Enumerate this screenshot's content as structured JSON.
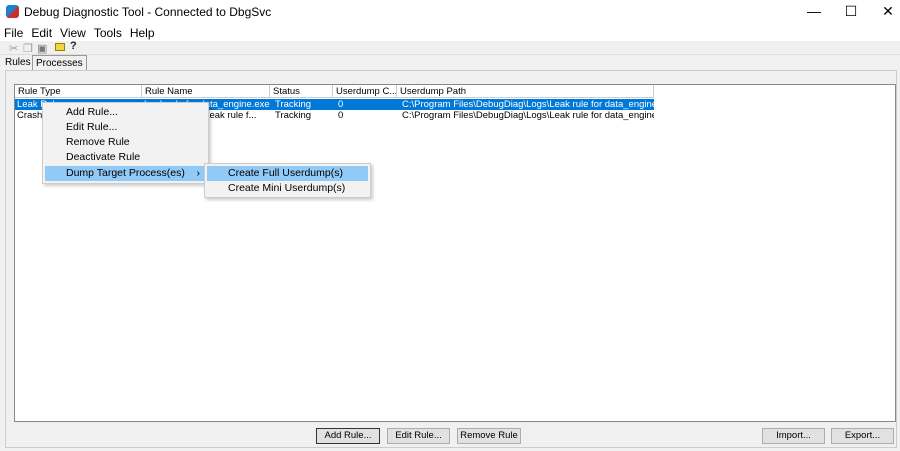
{
  "window": {
    "title": "Debug Diagnostic Tool - Connected to DbgSvc",
    "minimize": "—",
    "maximize": "☐",
    "close": "✕"
  },
  "menu": [
    "File",
    "Edit",
    "View",
    "Tools",
    "Help"
  ],
  "toolbar": {
    "icons": [
      "cut-icon",
      "copy-icon",
      "paste-icon",
      "open-folder-icon",
      "help-icon"
    ]
  },
  "tabs": [
    "Rules",
    "Processes"
  ],
  "columns": [
    "Rule Type",
    "Rule Name",
    "Status",
    "Userdump C...",
    "Userdump Path"
  ],
  "rows": [
    {
      "type": "Leak Rule",
      "name": "Leak rule for data_engine.exe(...",
      "status": "Tracking",
      "count": "0",
      "path": "C:\\Program Files\\DebugDiag\\Logs\\Leak rule for data_engine.exe(..."
    },
    {
      "type": "Crash Rule",
      "name": "Crash rule for Leak rule f...",
      "status": "Tracking",
      "count": "0",
      "path": "C:\\Program Files\\DebugDiag\\Logs\\Leak rule for data_engine.exe(..."
    }
  ],
  "context_menu": [
    "Add Rule...",
    "Edit Rule...",
    "Remove Rule",
    "Deactivate Rule",
    "Dump Target Process(es)"
  ],
  "submenu_arrow": "›",
  "submenu": [
    "Create Full Userdump(s)",
    "Create Mini Userdump(s)"
  ],
  "buttons": {
    "add": "Add Rule...",
    "edit": "Edit Rule...",
    "remove": "Remove Rule",
    "import": "Import...",
    "export": "Export..."
  }
}
